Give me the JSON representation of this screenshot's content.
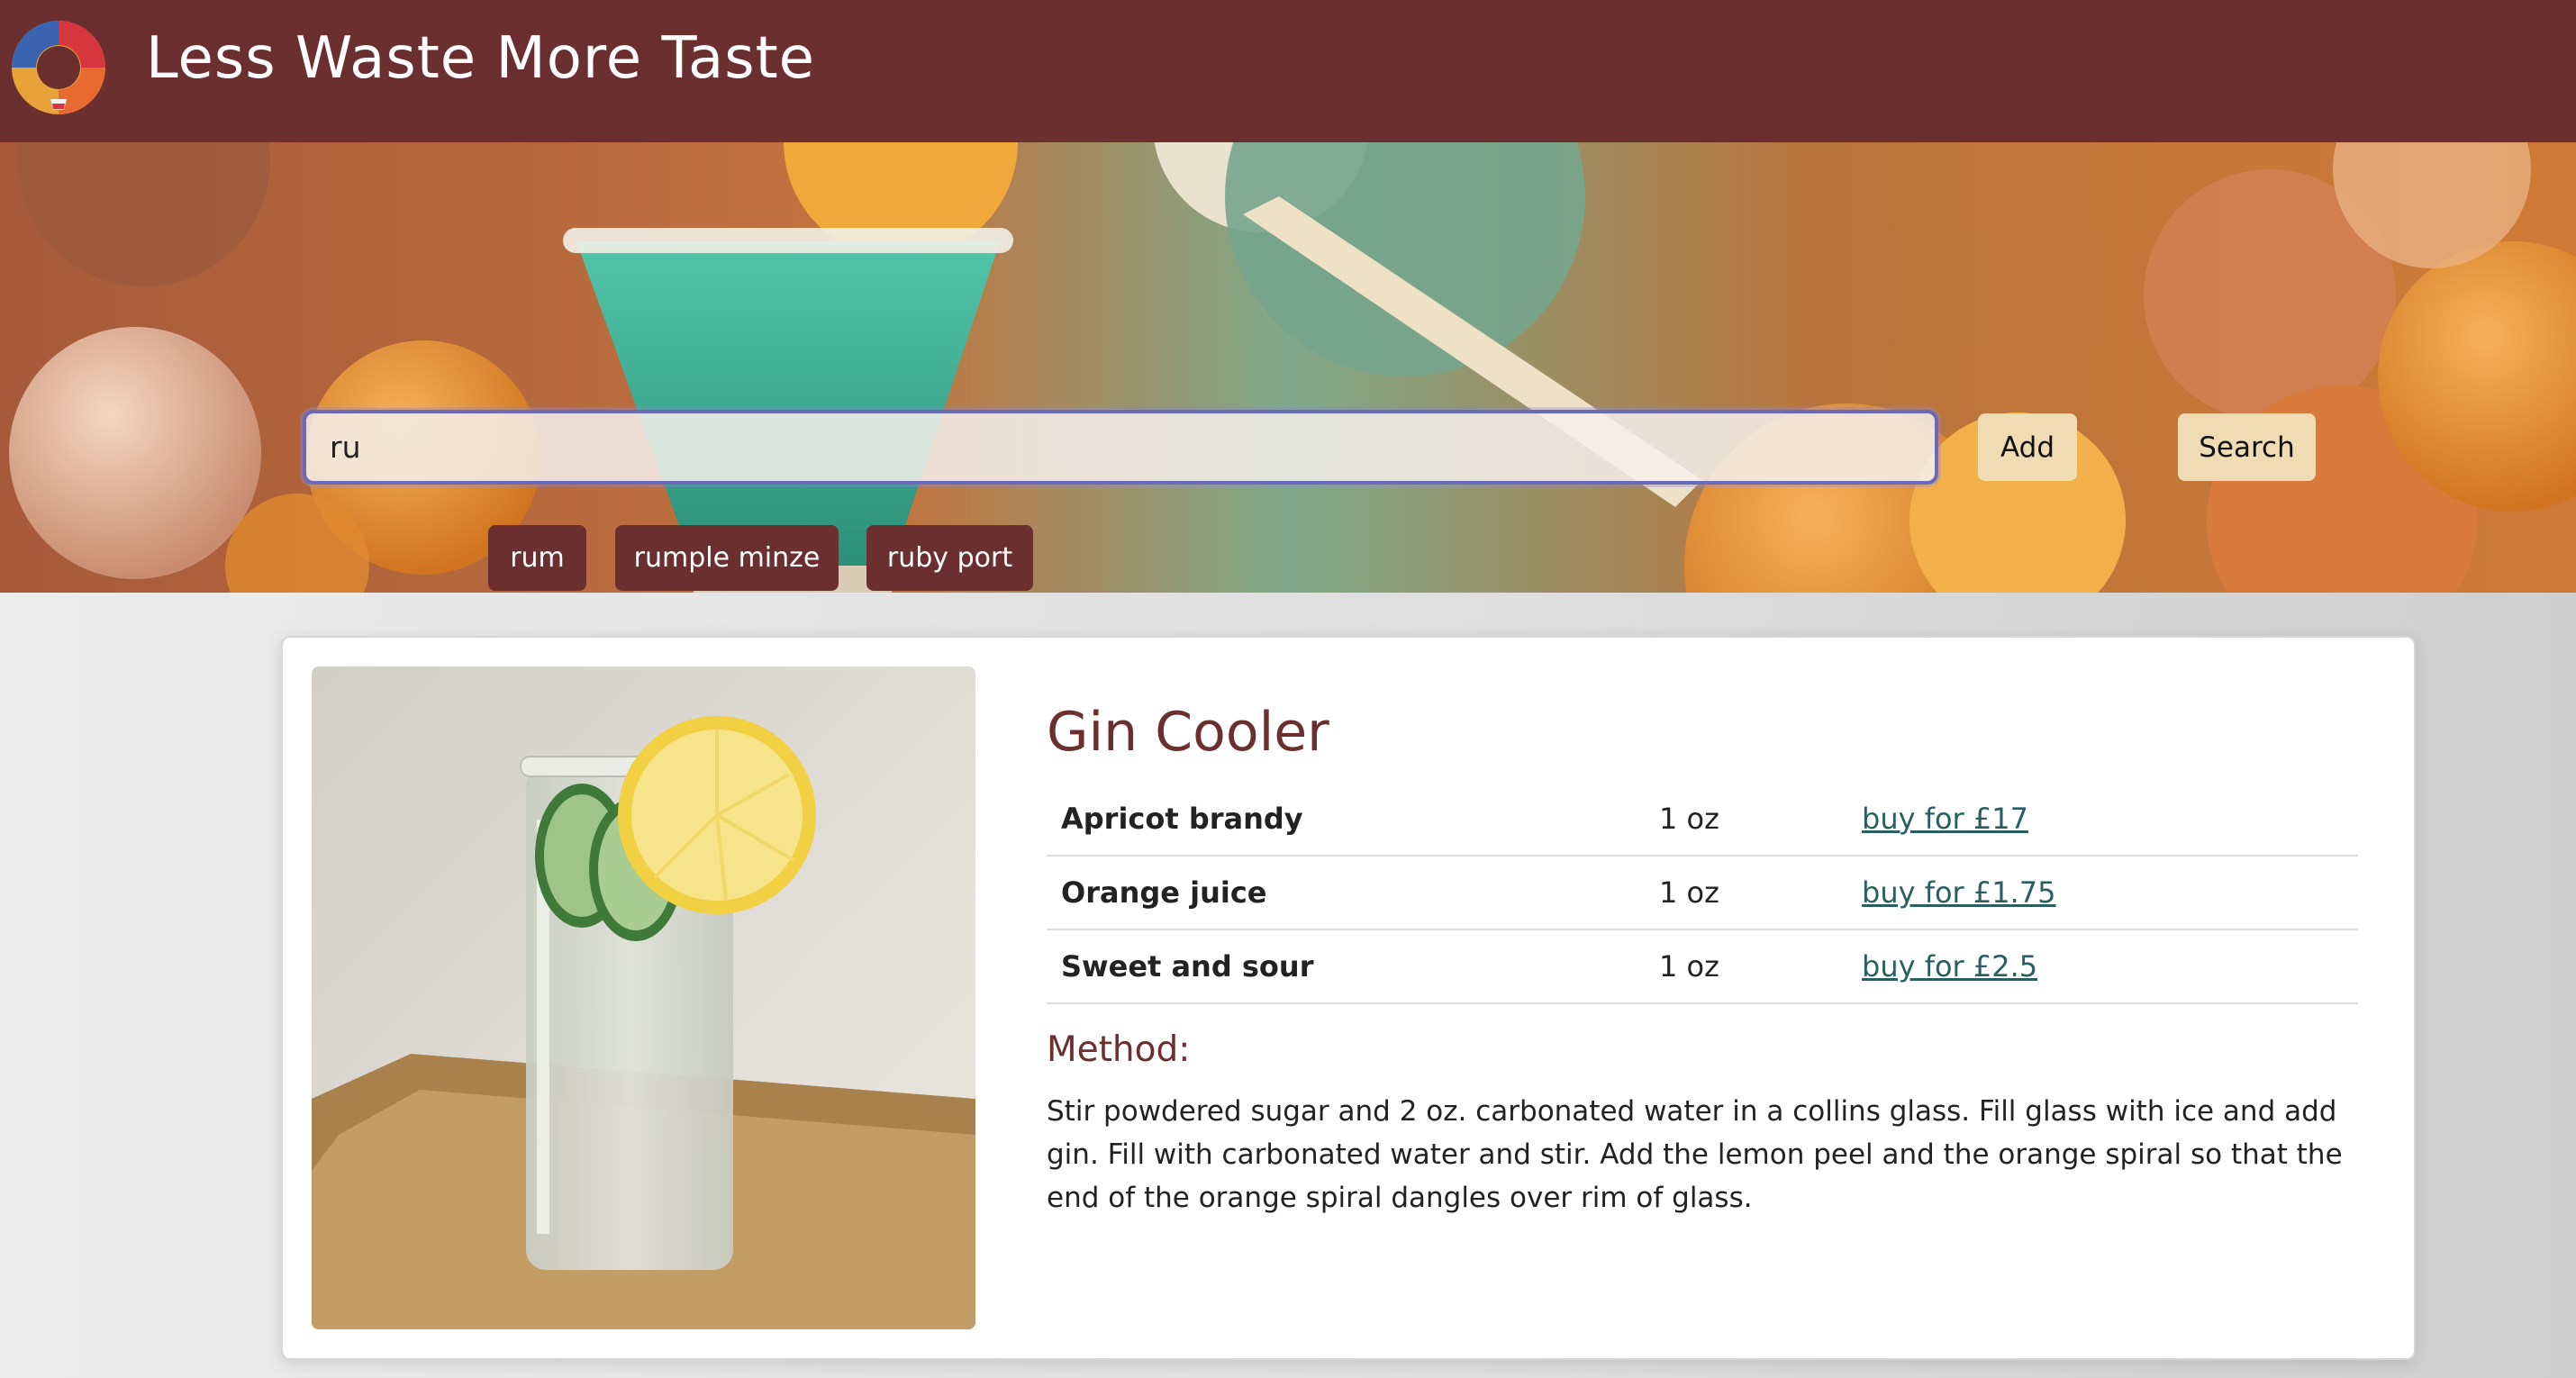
{
  "header": {
    "title": "Less Waste More Taste",
    "logo_icon": "cocktail-glass-ring-logo"
  },
  "search": {
    "value": "ru",
    "add_label": "Add",
    "search_label": "Search"
  },
  "suggestions": [
    "rum",
    "rumple minze",
    "ruby port"
  ],
  "recipe": {
    "name": "Gin Cooler",
    "image_description_icon": "highball-glass-photo",
    "ingredients": [
      {
        "name": "Apricot brandy",
        "quantity": "1 oz",
        "buy": "buy for £17"
      },
      {
        "name": "Orange juice",
        "quantity": "1 oz",
        "buy": "buy for £1.75"
      },
      {
        "name": "Sweet and sour",
        "quantity": "1 oz",
        "buy": "buy for £2.5"
      }
    ],
    "method_title": "Method:",
    "method_text": "Stir powdered sugar and 2 oz. carbonated water in a collins glass. Fill glass with ice and add gin. Fill with carbonated water and stir. Add the lemon peel and the orange spiral so that the end of the orange spiral dangles over rim of glass."
  },
  "colors": {
    "brand": "#6a2f2e",
    "button_light": "#efdcb4",
    "link": "#2a5f62"
  }
}
